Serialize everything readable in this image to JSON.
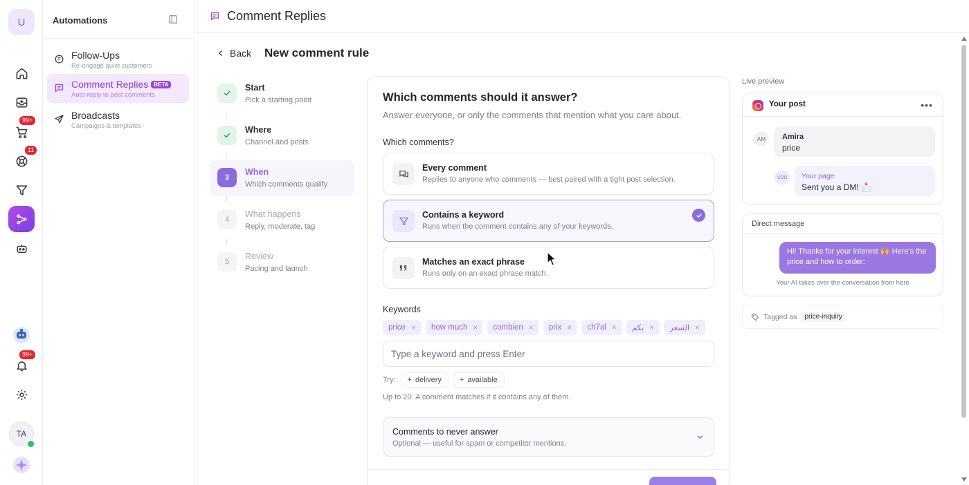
{
  "rail": {
    "avatar": "U",
    "badges": {
      "cart": "99+",
      "support": "11",
      "notifications": "99+"
    },
    "user_initials": "TA"
  },
  "nav": {
    "title": "Automations",
    "items": [
      {
        "label": "Follow-Ups",
        "sub": "Re-engage quiet customers"
      },
      {
        "label": "Comment Replies",
        "badge": "BETA",
        "sub": "Auto-reply to post comments"
      },
      {
        "label": "Broadcasts",
        "sub": "Campaigns & templates"
      }
    ]
  },
  "header": {
    "title": "Comment Replies"
  },
  "page": {
    "back_label": "Back",
    "title": "New comment rule"
  },
  "steps": [
    {
      "num": "✓",
      "label": "Start",
      "sub": "Pick a starting point",
      "state": "done"
    },
    {
      "num": "✓",
      "label": "Where",
      "sub": "Channel and posts",
      "state": "done"
    },
    {
      "num": "3",
      "label": "When",
      "sub": "Which comments qualify",
      "state": "current"
    },
    {
      "num": "4",
      "label": "What happens",
      "sub": "Reply, moderate, tag",
      "state": "todo"
    },
    {
      "num": "5",
      "label": "Review",
      "sub": "Pacing and launch",
      "state": "todo"
    }
  ],
  "form": {
    "title": "Which comments should it answer?",
    "description": "Answer everyone, or only the comments that mention what you care about.",
    "which_label": "Which comments?",
    "options": [
      {
        "title": "Every comment",
        "sub": "Replies to anyone who comments — best paired with a tight post selection.",
        "icon": "comments-icon"
      },
      {
        "title": "Contains a keyword",
        "sub": "Runs when the comment contains any of your keywords.",
        "icon": "filter-icon",
        "selected": true
      },
      {
        "title": "Matches an exact phrase",
        "sub": "Runs only on an exact phrase match.",
        "icon": "quote-icon"
      }
    ],
    "keywords_label": "Keywords",
    "keywords": [
      "price",
      "how much",
      "combien",
      "prix",
      "ch7al",
      "بكم",
      "السعر"
    ],
    "keyword_placeholder": "Type a keyword and press Enter",
    "try_label": "Try:",
    "suggestions": [
      "delivery",
      "available"
    ],
    "hint": "Up to 20. A comment matches if it contains any of them.",
    "never": {
      "title": "Comments to never answer",
      "sub": "Optional — useful for spam or competitor mentions."
    }
  },
  "preview": {
    "label": "Live preview",
    "post_title": "Your post",
    "comment": {
      "initials": "AM",
      "name": "Amira",
      "text": "price"
    },
    "reply": {
      "initials": "YOU",
      "name": "Your page",
      "text": "Sent you a DM! 📩"
    },
    "dm_title": "Direct message",
    "dm_text": "Hi! Thanks for your interest 🙌 Here's the price and how to order:",
    "dm_note": "Your AI takes over the conversation from here",
    "tagged_label": "Tagged as",
    "tag": "price-inquiry"
  },
  "colors": {
    "accent": "#8a6be0",
    "brand": "#9b45d9",
    "badge": "#e4252f",
    "success": "#2e9e57"
  }
}
